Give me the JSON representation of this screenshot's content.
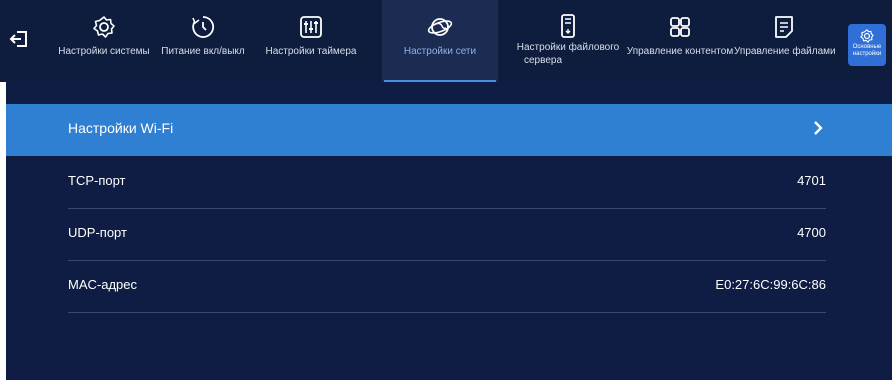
{
  "nav": {
    "tabs": [
      {
        "label_lines": [
          "Настройки системы"
        ],
        "icon": "gear-icon"
      },
      {
        "label_lines": [
          "Питание вкл/выкл"
        ],
        "icon": "power-timer-icon"
      },
      {
        "label_lines": [
          "Настройки таймера"
        ],
        "icon": "sliders-icon"
      },
      {
        "label_lines": [
          "Настройки сети"
        ],
        "icon": "network-globe-icon",
        "active": true
      },
      {
        "label_lines": [
          "Настройки файлового",
          "сервера"
        ],
        "icon": "server-icon"
      },
      {
        "label_lines": [
          "Управление контентом"
        ],
        "icon": "grid-icon"
      },
      {
        "label_lines": [
          "Управление файлами"
        ],
        "icon": "document-icon"
      }
    ],
    "side_button": {
      "label_lines": [
        "Основные",
        "настройки"
      ],
      "icon": "gear-icon"
    },
    "back_icon": "back-exit-icon"
  },
  "settings": {
    "wifi": {
      "label": "Настройки Wi-Fi",
      "icon": "chevron-right-icon"
    },
    "rows": [
      {
        "label": "TCP-порт",
        "value": "4701"
      },
      {
        "label": "UDP-порт",
        "value": "4700"
      },
      {
        "label": "MAC-адрес",
        "value": "E0:27:6C:99:6C:86"
      }
    ]
  },
  "colors": {
    "topbar_bg": "#0e1c3d",
    "content_bg": "#0f1d44",
    "highlight": "#2f7fd3",
    "active_underline": "#4a8ee0",
    "side_button_bg": "#2f6fd6"
  }
}
